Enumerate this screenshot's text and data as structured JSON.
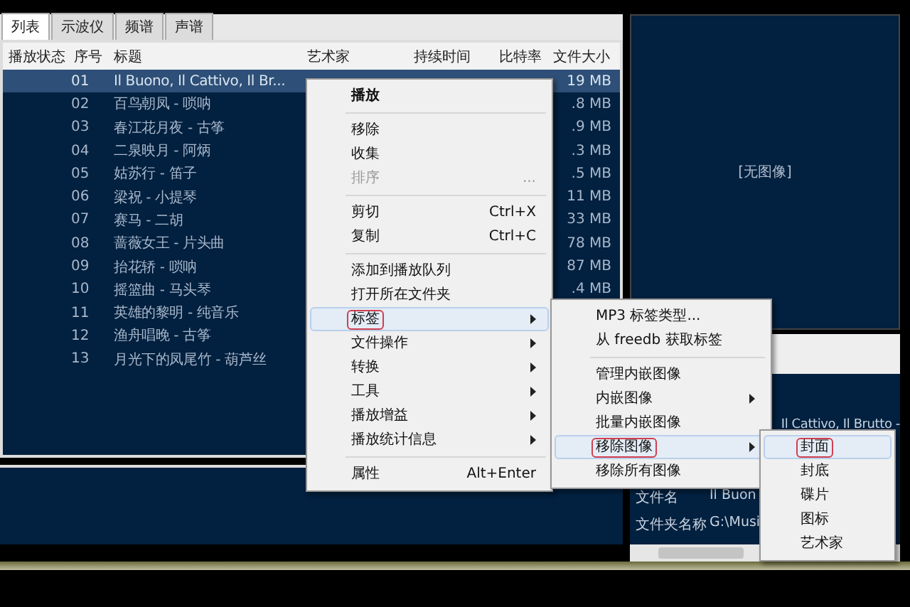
{
  "tabs": [
    {
      "label": "列表",
      "selected": true
    },
    {
      "label": "示波仪",
      "selected": false
    },
    {
      "label": "频谱",
      "selected": false
    },
    {
      "label": "声谱",
      "selected": false
    }
  ],
  "table": {
    "columns": [
      "播放状态",
      "序号",
      "标题",
      "艺术家",
      "持续时间",
      "比特率",
      "文件大小"
    ],
    "rows": [
      {
        "number": "01",
        "title": "Il Buono, Il Cattivo, Il Br...",
        "size": "19 MB",
        "selected": true
      },
      {
        "number": "02",
        "title": "百鸟朝凤 - 唢呐",
        "size": ".8 MB",
        "selected": false
      },
      {
        "number": "03",
        "title": "春江花月夜 - 古筝",
        "size": ".9 MB",
        "selected": false
      },
      {
        "number": "04",
        "title": "二泉映月 - 阿炳",
        "size": ".3 MB",
        "selected": false
      },
      {
        "number": "05",
        "title": "姑苏行 - 笛子",
        "size": ".5 MB",
        "selected": false
      },
      {
        "number": "06",
        "title": "梁祝 - 小提琴",
        "size": "11 MB",
        "selected": false
      },
      {
        "number": "07",
        "title": "赛马 - 二胡",
        "size": "33 MB",
        "selected": false
      },
      {
        "number": "08",
        "title": "蔷薇女王 - 片头曲",
        "size": "78 MB",
        "selected": false
      },
      {
        "number": "09",
        "title": "抬花轿 - 唢呐",
        "size": "87 MB",
        "selected": false
      },
      {
        "number": "10",
        "title": "摇篮曲 - 马头琴",
        "size": ".4 MB",
        "selected": false
      },
      {
        "number": "11",
        "title": "英雄的黎明 - 纯音乐",
        "selected": false
      },
      {
        "number": "12",
        "title": "渔舟唱晚 - 古筝",
        "selected": false
      },
      {
        "number": "13",
        "title": "月光下的凤尾竹 - 葫芦丝",
        "selected": false
      }
    ]
  },
  "album_art": {
    "text": "[无图像]"
  },
  "info_panel": {
    "rows": [
      {
        "value": "Il Cattivo, Il Brutto -"
      },
      {
        "label": "文件名",
        "value": "Il Buon"
      },
      {
        "label": "文件夹名称",
        "value": "G:\\Musi"
      }
    ]
  },
  "context_menu": [
    {
      "kind": "item",
      "label": "播放",
      "bold": true,
      "disabled": false,
      "submenu": false,
      "selected": false
    },
    {
      "kind": "separator"
    },
    {
      "kind": "item",
      "label": "移除",
      "bold": false,
      "disabled": false,
      "submenu": false,
      "selected": false
    },
    {
      "kind": "item",
      "label": "收集",
      "bold": false,
      "disabled": false,
      "submenu": false,
      "selected": false
    },
    {
      "kind": "item",
      "label": "排序",
      "shortcut": "...",
      "bold": false,
      "disabled": true,
      "submenu": false,
      "selected": false
    },
    {
      "kind": "separator"
    },
    {
      "kind": "item",
      "label": "剪切",
      "shortcut": "Ctrl+X",
      "bold": false,
      "disabled": false,
      "submenu": false,
      "selected": false
    },
    {
      "kind": "item",
      "label": "复制",
      "shortcut": "Ctrl+C",
      "bold": false,
      "disabled": false,
      "submenu": false,
      "selected": false
    },
    {
      "kind": "separator"
    },
    {
      "kind": "item",
      "label": "添加到播放队列",
      "bold": false,
      "disabled": false,
      "submenu": false,
      "selected": false
    },
    {
      "kind": "item",
      "label": "打开所在文件夹",
      "bold": false,
      "disabled": false,
      "submenu": false,
      "selected": false
    },
    {
      "kind": "item",
      "label": "标签",
      "bold": false,
      "disabled": false,
      "submenu": true,
      "selected": true
    },
    {
      "kind": "item",
      "label": "文件操作",
      "bold": false,
      "disabled": false,
      "submenu": true,
      "selected": false
    },
    {
      "kind": "item",
      "label": "转换",
      "bold": false,
      "disabled": false,
      "submenu": true,
      "selected": false
    },
    {
      "kind": "item",
      "label": "工具",
      "bold": false,
      "disabled": false,
      "submenu": true,
      "selected": false
    },
    {
      "kind": "item",
      "label": "播放增益",
      "bold": false,
      "disabled": false,
      "submenu": true,
      "selected": false
    },
    {
      "kind": "item",
      "label": "播放统计信息",
      "bold": false,
      "disabled": false,
      "submenu": true,
      "selected": false
    },
    {
      "kind": "separator"
    },
    {
      "kind": "item",
      "label": "属性",
      "shortcut": "Alt+Enter",
      "bold": false,
      "disabled": false,
      "submenu": false,
      "selected": false
    }
  ],
  "tag_submenu": [
    {
      "kind": "item",
      "label": "MP3 标签类型...",
      "submenu": false,
      "selected": false
    },
    {
      "kind": "item",
      "label": "从 freedb 获取标签",
      "submenu": false,
      "selected": false
    },
    {
      "kind": "separator"
    },
    {
      "kind": "item",
      "label": "管理内嵌图像",
      "submenu": false,
      "selected": false
    },
    {
      "kind": "item",
      "label": "内嵌图像",
      "submenu": true,
      "selected": false
    },
    {
      "kind": "item",
      "label": "批量内嵌图像",
      "submenu": false,
      "selected": false
    },
    {
      "kind": "item",
      "label": "移除图像",
      "submenu": true,
      "selected": true
    },
    {
      "kind": "item",
      "label": "移除所有图像",
      "submenu": false,
      "selected": false
    }
  ],
  "remove_image_submenu": [
    {
      "kind": "item",
      "label": "封面",
      "submenu": false,
      "selected": true
    },
    {
      "kind": "item",
      "label": "封底",
      "submenu": false,
      "selected": false
    },
    {
      "kind": "item",
      "label": "碟片",
      "submenu": false,
      "selected": false
    },
    {
      "kind": "item",
      "label": "图标",
      "submenu": false,
      "selected": false
    },
    {
      "kind": "item",
      "label": "艺术家",
      "submenu": false,
      "selected": false
    }
  ]
}
